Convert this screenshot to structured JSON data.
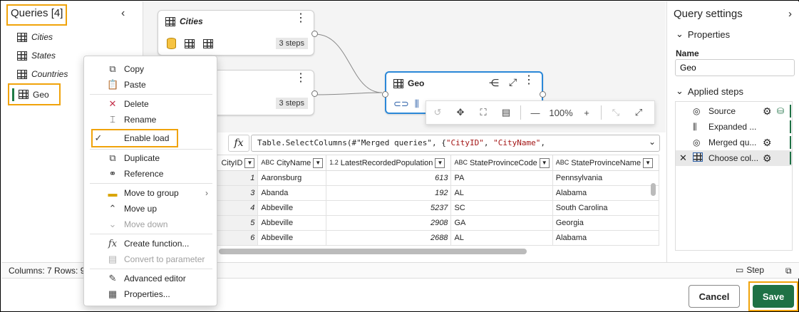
{
  "queries": {
    "title": "Queries [4]",
    "items": [
      "Cities",
      "States",
      "Countries",
      "Geo"
    ]
  },
  "diagram": {
    "cards": [
      {
        "title": "Cities",
        "steps": "3 steps"
      },
      {
        "title": "",
        "steps": "3 steps"
      },
      {
        "title": "Geo"
      }
    ],
    "zoom": "100%"
  },
  "formula": {
    "fx": "fx",
    "code_prefix": "Table.SelectColumns(#\"Merged queries\", {",
    "code_s1": "\"CityID\"",
    "code_mid": ", ",
    "code_s2": "\"CityName\"",
    "code_suffix": ","
  },
  "grid": {
    "columns": [
      {
        "type": "",
        "name": "CityID"
      },
      {
        "type": "ABC",
        "name": "CityName"
      },
      {
        "type": "1.2",
        "name": "LatestRecordedPopulation"
      },
      {
        "type": "ABC",
        "name": "StateProvinceCode"
      },
      {
        "type": "ABC",
        "name": "StateProvinceName"
      }
    ],
    "rows": [
      [
        "1",
        "Aaronsburg",
        "613",
        "PA",
        "Pennsylvania"
      ],
      [
        "3",
        "Abanda",
        "192",
        "AL",
        "Alabama"
      ],
      [
        "4",
        "Abbeville",
        "5237",
        "SC",
        "South Carolina"
      ],
      [
        "5",
        "Abbeville",
        "2908",
        "GA",
        "Georgia"
      ],
      [
        "6",
        "Abbeville",
        "2688",
        "AL",
        "Alabama"
      ]
    ]
  },
  "status": {
    "left": "Columns: 7   Rows: 9",
    "step": "Step"
  },
  "footer": {
    "cancel": "Cancel",
    "save": "Save"
  },
  "settings": {
    "title": "Query settings",
    "properties": "Properties",
    "name_label": "Name",
    "name_value": "Geo",
    "applied_steps": "Applied steps",
    "steps": [
      "Source",
      "Expanded ...",
      "Merged qu...",
      "Choose col..."
    ]
  },
  "menu": {
    "items": [
      "Copy",
      "Paste",
      "Delete",
      "Rename",
      "Enable load",
      "Duplicate",
      "Reference",
      "Move to group",
      "Move up",
      "Move down",
      "Create function...",
      "Convert to parameter",
      "Advanced editor",
      "Properties..."
    ]
  },
  "colors": {
    "accent_green": "#1e7145",
    "highlight": "#f0a30a",
    "selected_blue": "#2b88d8"
  }
}
